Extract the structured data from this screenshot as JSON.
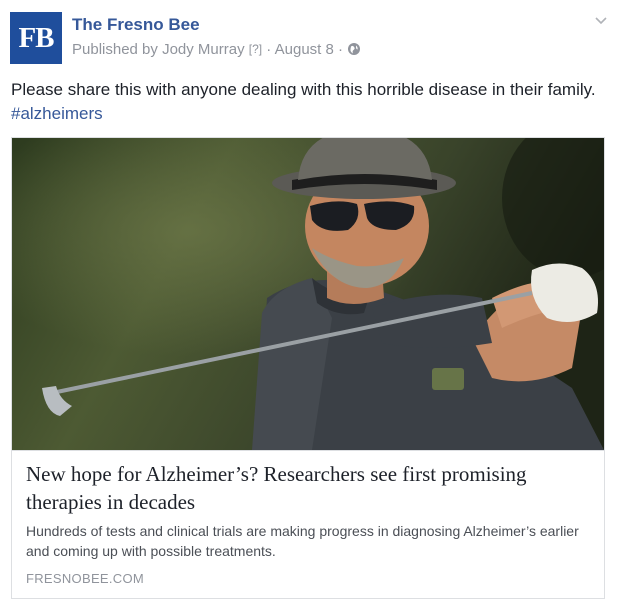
{
  "post": {
    "page_name": "The Fresno Bee",
    "logo_text": "FB",
    "published_by_label": "Published by",
    "publisher": "Jody Murray",
    "help_marker": "[?]",
    "date": "August 8",
    "separator": "·",
    "privacy_icon": "globe-icon",
    "options_icon": "chevron-down-icon",
    "message_text": "Please share this with anyone dealing with this horrible disease in their family. ",
    "hashtag": "#alzheimers"
  },
  "link_card": {
    "image_icon": "photo-golfer-swinging",
    "title": "New hope for Alzheimer’s? Researchers see first promising therapies in decades",
    "description": "Hundreds of tests and clinical trials are making progress in diagnosing Alzheimer’s earlier and coming up with possible treatments.",
    "domain": "FRESNOBEE.COM"
  },
  "colors": {
    "brand_blue": "#1f4e9c",
    "link_blue": "#365899",
    "meta_gray": "#90949c",
    "text_dark": "#1d2129"
  }
}
